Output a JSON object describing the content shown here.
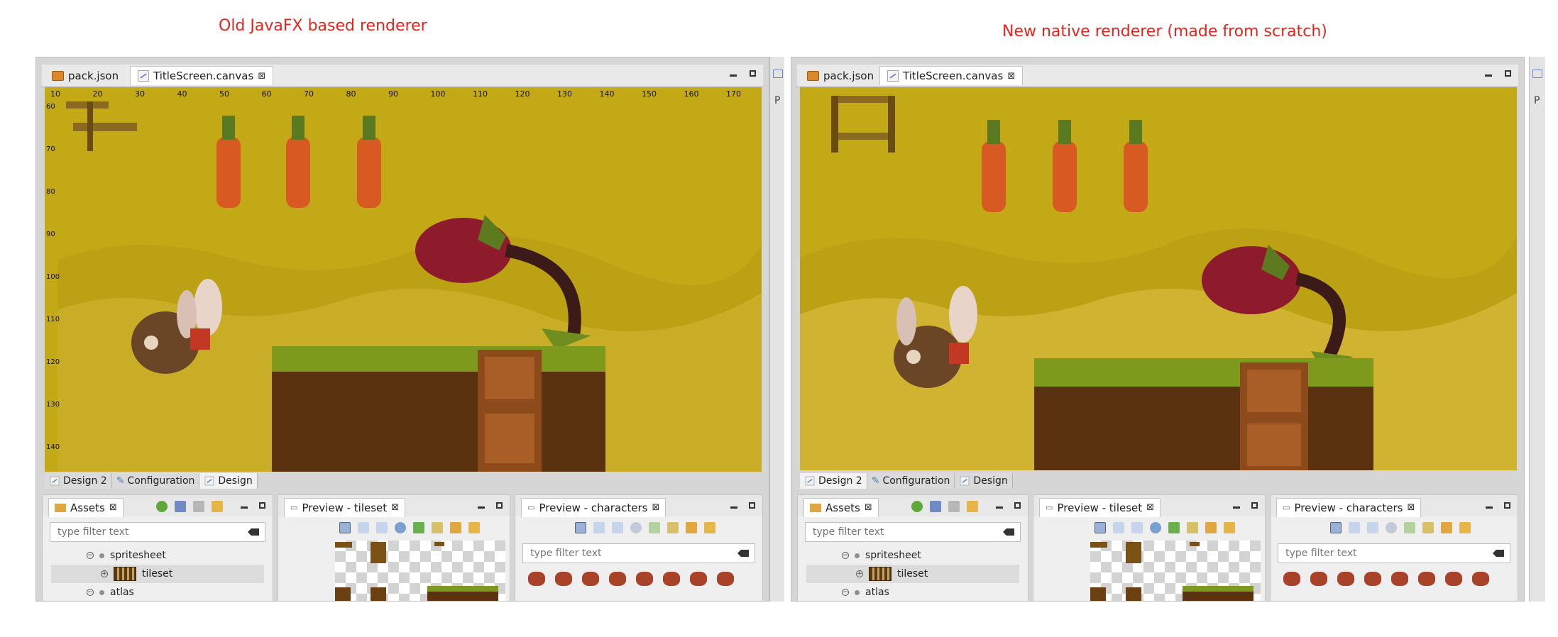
{
  "captions": {
    "left": "Old JavaFX based renderer",
    "right": "New native renderer (made from scratch)"
  },
  "editor": {
    "tabs": [
      {
        "label": "pack.json",
        "icon": "json-file-icon"
      },
      {
        "label": "TitleScreen.canvas",
        "icon": "canvas-file-icon"
      }
    ],
    "side_letter": "P"
  },
  "rulers": {
    "top": [
      "10",
      "20",
      "30",
      "40",
      "50",
      "60",
      "70",
      "80",
      "90",
      "100",
      "110",
      "120",
      "130",
      "140",
      "150",
      "160",
      "170"
    ],
    "left": [
      "60",
      "70",
      "80",
      "90",
      "100",
      "110",
      "120",
      "130",
      "140"
    ]
  },
  "bottom_tabs": [
    "Design 2",
    "Configuration",
    "Design"
  ],
  "views": {
    "assets": {
      "title": "Assets",
      "filter_placeholder": "type filter text",
      "tree": [
        {
          "label": "spritesheet"
        },
        {
          "label": "tileset"
        },
        {
          "label": "atlas"
        }
      ]
    },
    "preview_tileset": {
      "title": "Preview - tileset"
    },
    "preview_characters": {
      "title": "Preview - characters",
      "filter_placeholder": "type filter text"
    }
  },
  "colors": {
    "caption": "#e8231c",
    "canvas_bg": "#c4a916",
    "carrot": "#e0662a",
    "plant": "#9e1f2e",
    "ground": "#6b3a12",
    "grass": "#7a9a1e"
  }
}
